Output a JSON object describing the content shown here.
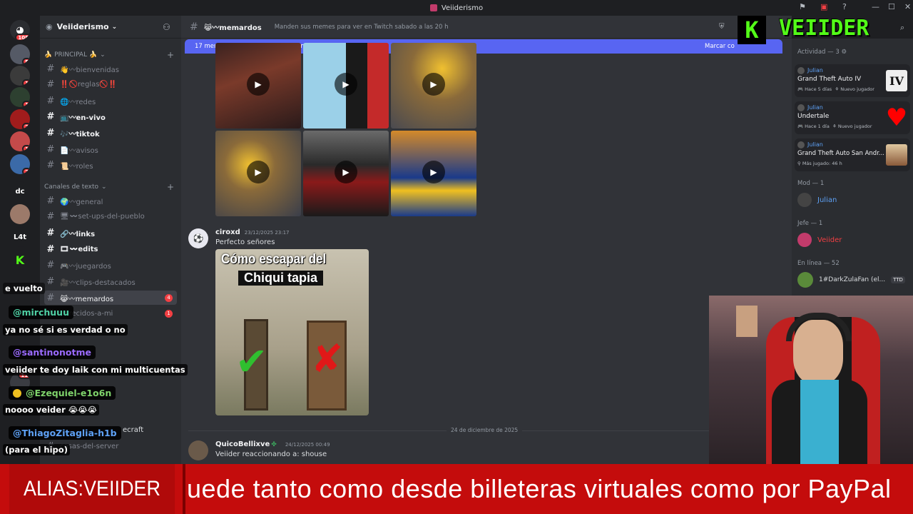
{
  "window": {
    "title": "Veiiderismo"
  },
  "rail": {
    "home_badge": "108",
    "badges": [
      "5",
      "1",
      "1",
      "2",
      "1",
      "2"
    ],
    "labels": [
      "dc",
      "L4t"
    ],
    "lower_badge": "119"
  },
  "server": {
    "name": "Veiiderismo"
  },
  "sidebar": {
    "categories": [
      {
        "label": "🍌 PRINCIPAL 🍌"
      },
      {
        "label": "Canales de texto"
      }
    ],
    "channels": [
      {
        "label": "👋〰bienvenidas",
        "unread": false,
        "count": ""
      },
      {
        "label": "‼️🚫reglas🚫‼️",
        "unread": false,
        "count": ""
      },
      {
        "label": "🌐〰redes",
        "unread": false,
        "count": ""
      },
      {
        "label": "📺〰en-vivo",
        "unread": true,
        "count": ""
      },
      {
        "label": "🎶〰tiktok",
        "unread": true,
        "count": ""
      },
      {
        "label": "📄〰avisos",
        "unread": false,
        "count": ""
      },
      {
        "label": "📜〰roles",
        "unread": false,
        "count": ""
      },
      {
        "label": "🌍〰general",
        "unread": false,
        "count": ""
      },
      {
        "label": "🖥〰set-ups-del-pueblo",
        "unread": false,
        "count": ""
      },
      {
        "label": "🔗〰links",
        "unread": true,
        "count": ""
      },
      {
        "label": "🎞〰edits",
        "unread": true,
        "count": ""
      },
      {
        "label": "🎮〰juegardos",
        "unread": false,
        "count": ""
      },
      {
        "label": "🎥〰clips-destacados",
        "unread": false,
        "count": ""
      },
      {
        "label": "😹〰memardos",
        "unread": false,
        "count": "4"
      },
      {
        "label": "parecidos-a-mi",
        "unread": false,
        "count": "1"
      },
      {
        "label": "cosas-del-server",
        "unread": false,
        "count": ""
      }
    ],
    "partial": [
      "ecraft"
    ]
  },
  "chat": {
    "channel": "😹〰memardos",
    "topic": "Manden sus memes para ver en Twitch sabado a las 20 h",
    "new_messages": "17 mensajes nuevos desde 2:05 p.m.",
    "mark_read": "Marcar co",
    "messages": [
      {
        "author": "ciroxd",
        "time": "23/12/2025 23:17",
        "text": "Perfecto señores"
      },
      {
        "author": "QuicoBellixve",
        "time": "24/12/2025 00:49",
        "text": "Veiider reaccionando a: shouse"
      }
    ],
    "date_divider": "24 de diciembre de 2025",
    "meme": {
      "line1": "Cómo escapar del",
      "line2": "Chiqui tapia"
    }
  },
  "members": {
    "activity_header": "Actividad — 3",
    "activities": [
      {
        "user": "Julian",
        "game": "Grand Theft Auto IV",
        "meta1": "Hace 5 días",
        "meta2": "Nuevo jugador",
        "art": "IV"
      },
      {
        "user": "Julian",
        "game": "Undertale",
        "meta1": "Hace 1 día",
        "meta2": "Nuevo jugador",
        "art": "♥"
      },
      {
        "user": "Julian",
        "game": "Grand Theft Auto San Andr...",
        "meta1": "Más jugado: 46 h",
        "meta2": "",
        "art": ""
      }
    ],
    "groups": [
      {
        "label": "Mod — 1",
        "member": "Julian"
      },
      {
        "label": "Jefe — 1",
        "member": "Veiider"
      },
      {
        "label": "En línea — 52",
        "member": "1#DarkZulaFan (el..."
      }
    ],
    "tag": "TTD"
  },
  "overlay": {
    "logo": "VEIIDER",
    "logo_letter": "K",
    "chat": [
      {
        "type": "msg",
        "text": "e vuelto"
      },
      {
        "type": "user",
        "text": "@mirchuuu",
        "color": "#4fd1a5"
      },
      {
        "type": "msg",
        "text": "ya no sé si es verdad o no"
      },
      {
        "type": "user",
        "text": "@santinonotme",
        "color": "#9b6bff"
      },
      {
        "type": "msg",
        "text": "veiider te doy laik con mi multicuentas"
      },
      {
        "type": "user",
        "text": "@Ezequiel-e1o6n",
        "color": "#7fd36b"
      },
      {
        "type": "msg",
        "text": "noooo veider 😭😭😭"
      },
      {
        "type": "user",
        "text": "@ThiagoZitaglia-h1b",
        "color": "#5ea1f5"
      },
      {
        "type": "msg",
        "text": "(para el hipo)"
      }
    ],
    "ticker_alias": "ALIAS:VEIIDER",
    "ticker_text": "uede tanto como desde billeteras virtuales como por PayPal"
  },
  "colors": {
    "accent": "#5865f2",
    "ticker": "#c40c0c",
    "kick": "#53fc18"
  }
}
